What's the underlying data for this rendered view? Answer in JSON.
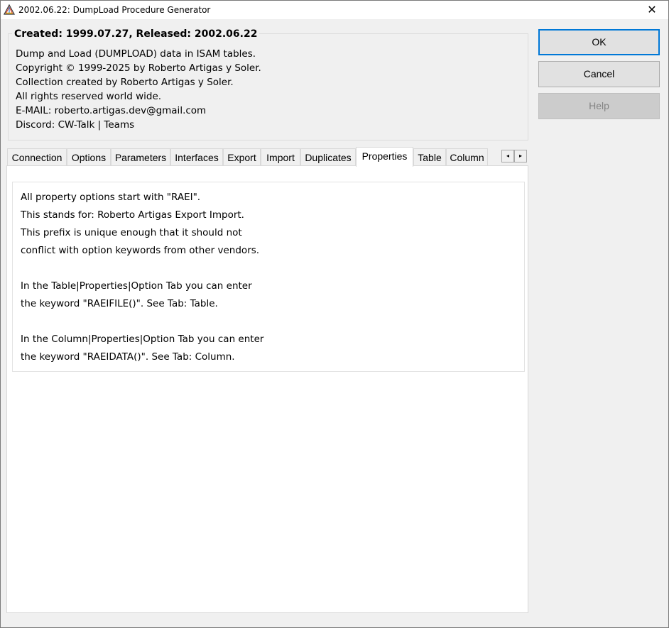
{
  "window": {
    "title": "2002.06.22: DumpLoad Procedure Generator",
    "close_glyph": "✕"
  },
  "info": {
    "heading": "Created: 1999.07.27, Released: 2002.06.22",
    "lines": [
      "Dump and Load (DUMPLOAD) data in ISAM tables.",
      "Copyright © 1999-2025 by Roberto Artigas y Soler.",
      "Collection created by Roberto Artigas y Soler.",
      "All rights reserved world wide.",
      "E-MAIL: roberto.artigas.dev@gmail.com",
      "Discord: CW-Talk | Teams"
    ]
  },
  "buttons": {
    "ok": "OK",
    "cancel": "Cancel",
    "help": "Help"
  },
  "tabs": [
    {
      "label": "Connection"
    },
    {
      "label": "Options"
    },
    {
      "label": "Parameters"
    },
    {
      "label": "Interfaces"
    },
    {
      "label": "Export"
    },
    {
      "label": "Import"
    },
    {
      "label": "Duplicates"
    },
    {
      "label": "Properties",
      "active": true
    },
    {
      "label": "Table"
    },
    {
      "label": "Column"
    }
  ],
  "tab_scroll": {
    "left_glyph": "◂",
    "right_glyph": "▸"
  },
  "properties_text": [
    "All property options start with \"RAEI\".",
    "This stands for: Roberto Artigas Export Import.",
    "This prefix is unique enough that it should not",
    "conflict with option keywords from other vendors.",
    "",
    "In the Table|Properties|Option Tab you can enter",
    "the keyword \"RAEIFILE()\". See Tab: Table.",
    "",
    "In the Column|Properties|Option Tab you can enter",
    "the keyword \"RAEIDATA()\". See Tab: Column."
  ]
}
